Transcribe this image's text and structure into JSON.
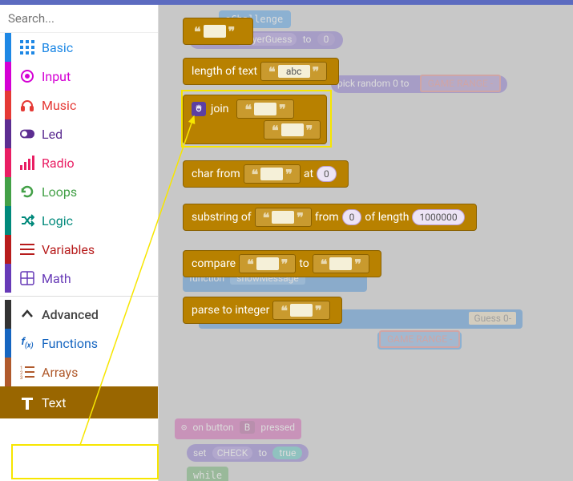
{
  "search": {
    "placeholder": "Search..."
  },
  "categories": [
    {
      "id": "basic",
      "label": "Basic",
      "color": "#1e88e5",
      "icon": "grid"
    },
    {
      "id": "input",
      "label": "Input",
      "color": "#d400d4",
      "icon": "target"
    },
    {
      "id": "music",
      "label": "Music",
      "color": "#e53935",
      "icon": "headphones"
    },
    {
      "id": "led",
      "label": "Led",
      "color": "#5c2d91",
      "icon": "toggle"
    },
    {
      "id": "radio",
      "label": "Radio",
      "color": "#e91e63",
      "icon": "bars"
    },
    {
      "id": "loops",
      "label": "Loops",
      "color": "#43a047",
      "icon": "refresh"
    },
    {
      "id": "logic",
      "label": "Logic",
      "color": "#00897b",
      "icon": "shuffle"
    },
    {
      "id": "variables",
      "label": "Variables",
      "color": "#b71c1c",
      "icon": "lines"
    },
    {
      "id": "math",
      "label": "Math",
      "color": "#673ab7",
      "icon": "calculator"
    }
  ],
  "advanced": {
    "label": "Advanced",
    "items": [
      {
        "id": "functions",
        "label": "Functions",
        "color": "#1565c0",
        "icon": "fx"
      },
      {
        "id": "arrays",
        "label": "Arrays",
        "color": "#b05a2c",
        "icon": "list-num"
      },
      {
        "id": "text",
        "label": "Text",
        "color": "#996600",
        "icon": "text-t",
        "active": true
      }
    ]
  },
  "blocks": {
    "string_literal": {
      "value": ""
    },
    "length_of_text": {
      "label": "length of text",
      "value": "abc"
    },
    "join": {
      "label": "join"
    },
    "char_from": {
      "label_from": "char from",
      "label_at": "at",
      "index": "0"
    },
    "substring": {
      "label_sub": "substring of",
      "label_from": "from",
      "from": "0",
      "label_len": "of length",
      "len": "1000000"
    },
    "compare": {
      "label": "compare",
      "label_to": "to"
    },
    "parse_int": {
      "label": "parse to integer"
    }
  },
  "background": {
    "header": "oChallenge",
    "set_var": "playerGuess",
    "to": "to",
    "zero": "0",
    "pick_random": "pick random 0 to",
    "game_range": "GAME RANGE -",
    "show_string": "show string",
    "guess_prefix": "Guess 0-",
    "function": "function",
    "show_message": "showMessage",
    "on_button": "on button",
    "pressed": "pressed",
    "btn": "B",
    "set_check": "set",
    "check_var": "CHECK",
    "true": "true",
    "while": "while"
  }
}
